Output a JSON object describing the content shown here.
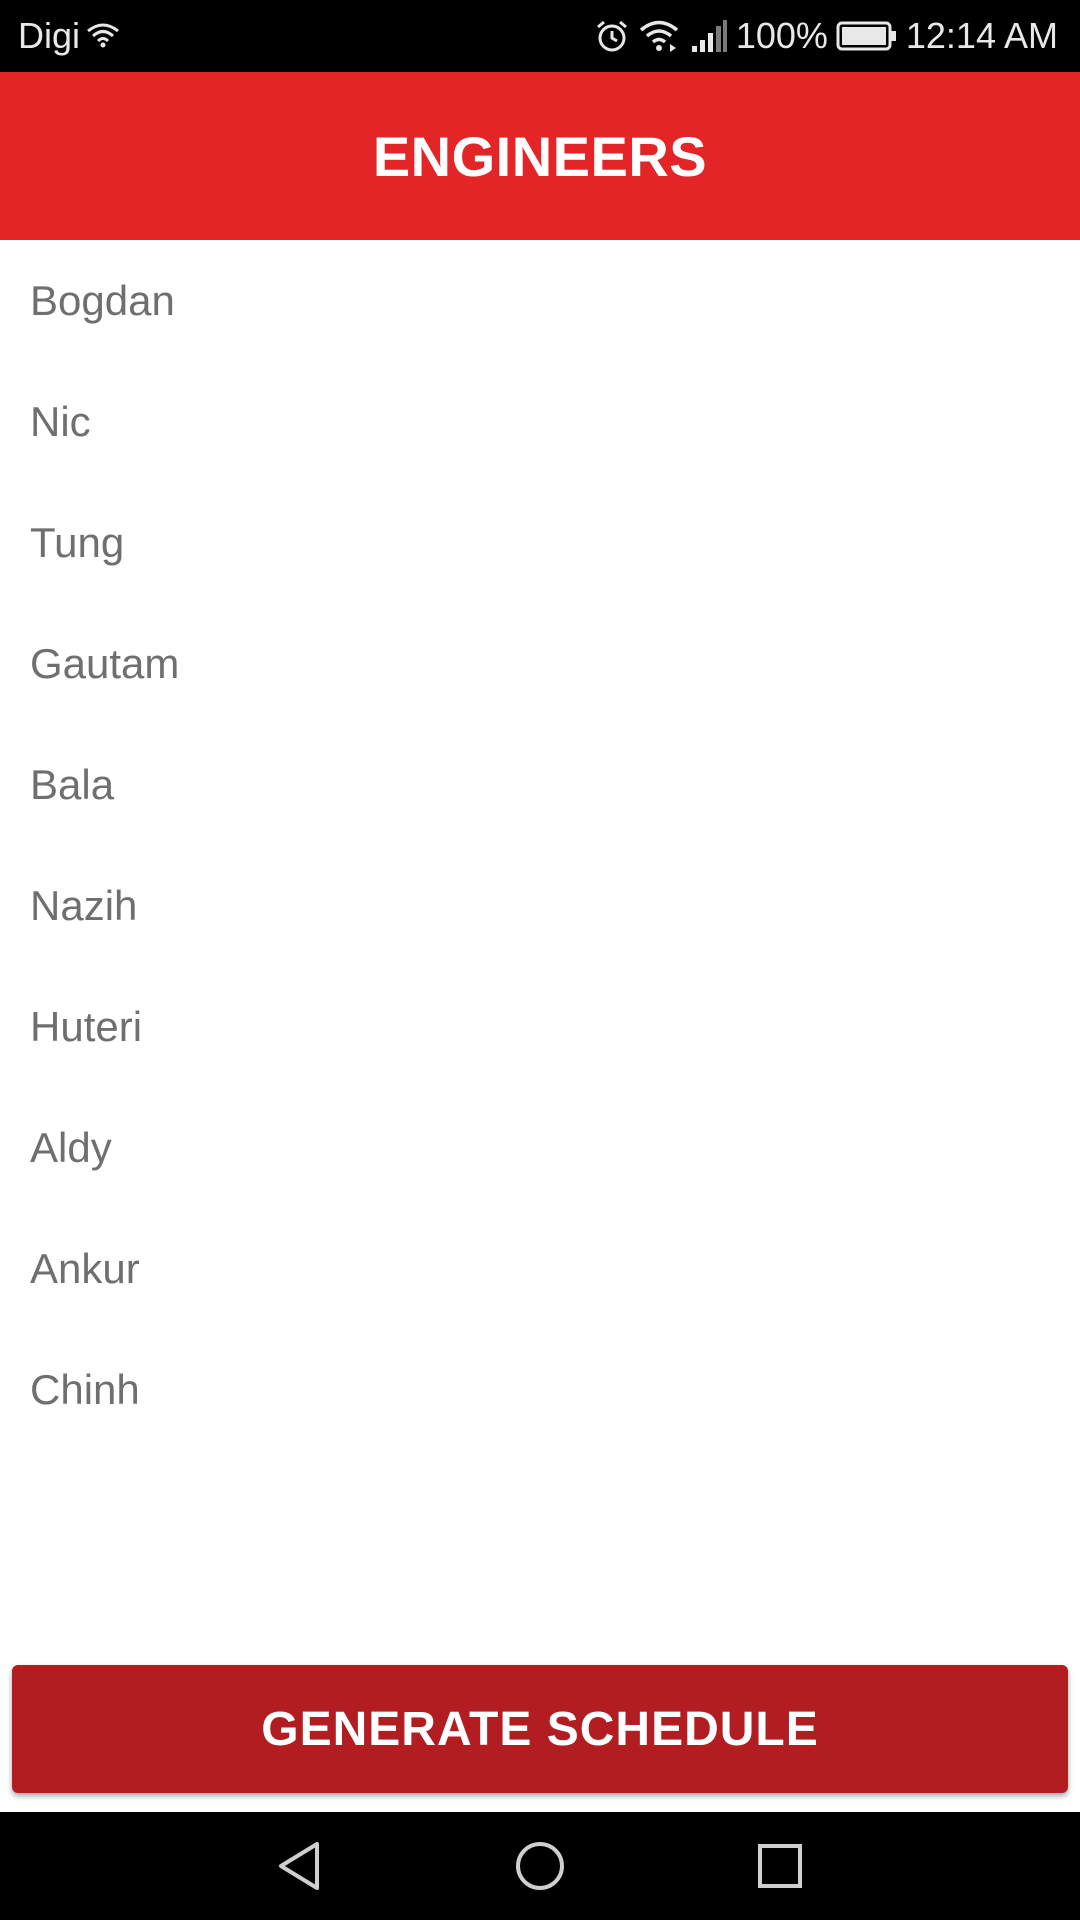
{
  "status_bar": {
    "carrier": "Digi",
    "battery": "100%",
    "time": "12:14 AM",
    "icons": [
      "wifi-icon",
      "alarm-icon",
      "wifi-icon",
      "signal-icon",
      "battery-icon"
    ]
  },
  "app_bar": {
    "title": "ENGINEERS",
    "color": "#e32528"
  },
  "engineers": [
    "Bogdan",
    "Nic",
    "Tung",
    "Gautam",
    "Bala",
    "Nazih",
    "Huteri",
    "Aldy",
    "Ankur",
    "Chinh"
  ],
  "actions": {
    "generate_label": "GENERATE SCHEDULE",
    "button_color": "#b11d21"
  },
  "nav_bar": {
    "icons": [
      "back-icon",
      "home-icon",
      "recents-icon"
    ]
  }
}
